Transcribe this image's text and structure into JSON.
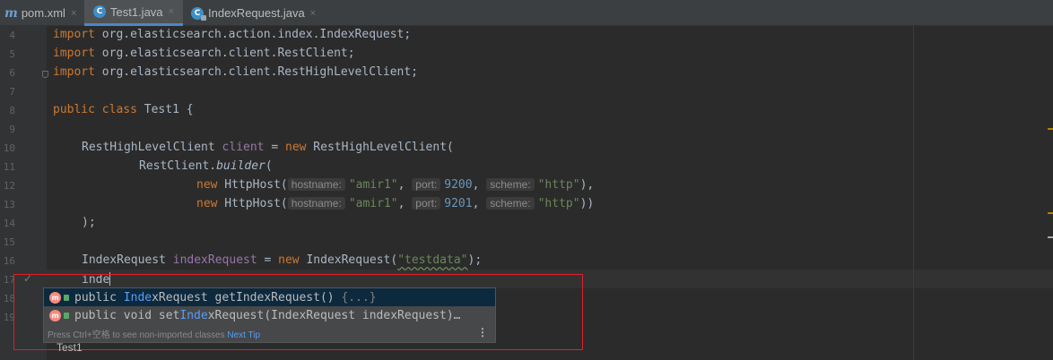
{
  "tabs": [
    {
      "icon": "maven-icon",
      "label": "pom.xml",
      "close": "×"
    },
    {
      "icon": "class-icon",
      "label": "Test1.java",
      "close": "×"
    },
    {
      "icon": "library-class-icon",
      "label": "IndexRequest.java",
      "close": "×"
    }
  ],
  "line_numbers": [
    "4",
    "5",
    "6",
    "7",
    "8",
    "9",
    "10",
    "11",
    "12",
    "13",
    "14",
    "15",
    "16",
    "17",
    "18",
    "19"
  ],
  "code": {
    "import1": {
      "kw": "import",
      "rest": " org.elasticsearch.action.index.IndexRequest;"
    },
    "import2": {
      "kw": "import",
      "rest": " org.elasticsearch.client.RestClient;"
    },
    "import3": {
      "kw": "import",
      "rest": " org.elasticsearch.client.RestHighLevelClient;"
    },
    "class_decl": {
      "kw1": "public",
      "kw2": "class",
      "name": "Test1",
      "brace": " {"
    },
    "line10": {
      "type": "RestHighLevelClient ",
      "var": "client",
      "eq": " = ",
      "kw": "new",
      "ctor": " RestHighLevelClient("
    },
    "line11": {
      "cls": "RestClient.",
      "method": "builder",
      "paren": "("
    },
    "line12": {
      "kw": "new",
      "cls": " HttpHost(",
      "hint1": "hostname:",
      "host": "\"amir1\"",
      "sep1": ", ",
      "hint2": "port:",
      "port": "9200",
      "sep2": ", ",
      "hint3": "scheme:",
      "scheme": "\"http\"",
      "end": "),"
    },
    "line13": {
      "kw": "new",
      "cls": " HttpHost(",
      "hint1": "hostname:",
      "host": "\"amir1\"",
      "sep1": ", ",
      "hint2": "port:",
      "port": "9201",
      "sep2": ", ",
      "hint3": "scheme:",
      "scheme": "\"http\"",
      "end": "))"
    },
    "line14": ");",
    "line16": {
      "type": "IndexRequest ",
      "var": "indexRequest",
      "eq": " = ",
      "kw": "new",
      "ctor": " IndexRequest(",
      "str": "\"testdata\"",
      "end": ");"
    },
    "line17": "inde"
  },
  "completion": {
    "items": [
      {
        "icon": "method-icon",
        "pre": "public ",
        "match": "Inde",
        "post": "xRequest getIndexRequest() ",
        "body": "{...}"
      },
      {
        "icon": "method-icon",
        "pre": "public void set",
        "match": "Inde",
        "post": "xRequest(IndexRequest indexRequest)…",
        "body": ""
      }
    ],
    "footer_text": "Press Ctrl+空格 to see non-imported classes ",
    "footer_link": "Next Tip",
    "menu_glyph": "⋮"
  },
  "bottom_label": "Test1",
  "colors": {
    "keyword": "#cc7832",
    "string": "#6a8759",
    "number": "#6897bb",
    "field": "#9876aa",
    "highlight_box": "#e0202a"
  }
}
